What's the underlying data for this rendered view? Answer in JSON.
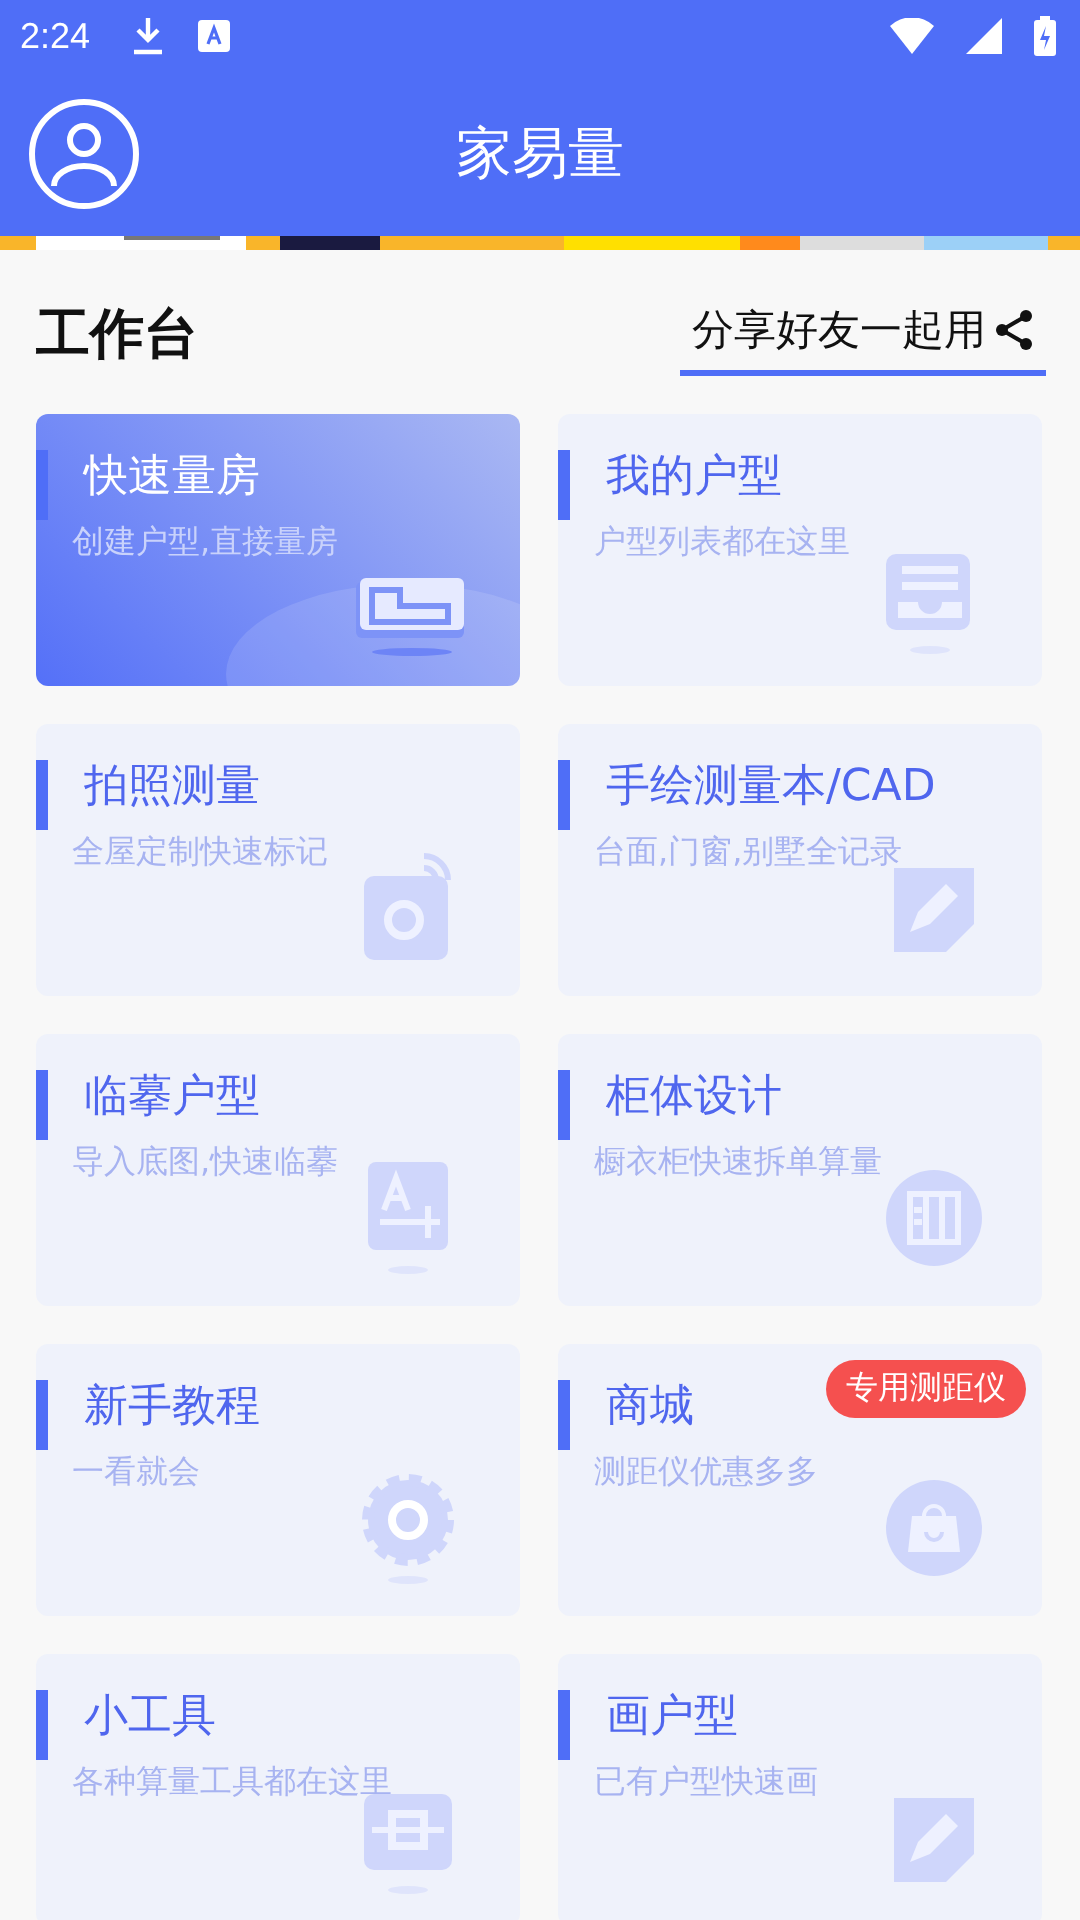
{
  "status_bar": {
    "time": "2:24"
  },
  "app_bar": {
    "title": "家易量"
  },
  "section": {
    "title": "工作台",
    "share": "分享好友一起用"
  },
  "cards": [
    {
      "title": "快速量房",
      "subtitle": "创建户型,直接量房",
      "selected": true
    },
    {
      "title": "我的户型",
      "subtitle": "户型列表都在这里",
      "selected": false
    },
    {
      "title": "拍照测量",
      "subtitle": "全屋定制快速标记",
      "selected": false
    },
    {
      "title": "手绘测量本/CAD",
      "subtitle": "台面,门窗,别墅全记录",
      "selected": false
    },
    {
      "title": "临摹户型",
      "subtitle": "导入底图,快速临摹",
      "selected": false
    },
    {
      "title": "柜体设计",
      "subtitle": "橱衣柜快速拆单算量",
      "selected": false
    },
    {
      "title": "新手教程",
      "subtitle": "一看就会",
      "selected": false
    },
    {
      "title": "商城",
      "subtitle": "测距仪优惠多多",
      "selected": false,
      "badge": "专用测距仪"
    },
    {
      "title": "小工具",
      "subtitle": "各种算量工具都在这里",
      "selected": false
    },
    {
      "title": "画户型",
      "subtitle": "已有户型快速画",
      "selected": false
    }
  ]
}
